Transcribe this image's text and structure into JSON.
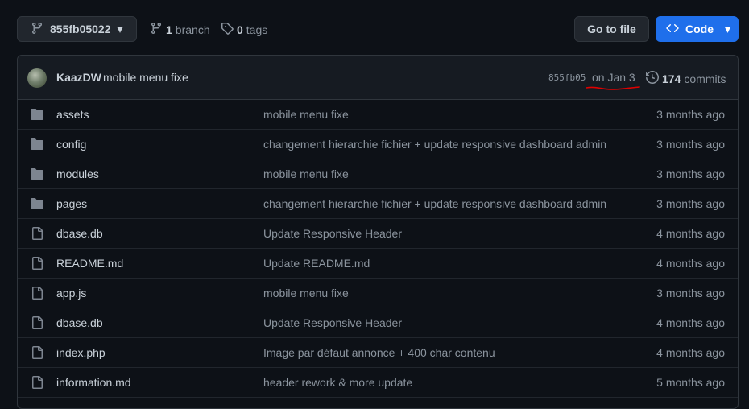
{
  "branch_selector": {
    "label": "855fb05022",
    "icon": "git-branch-icon",
    "caret": "▾"
  },
  "branches": {
    "count": "1",
    "label": "branch"
  },
  "tags": {
    "count": "0",
    "label": "tags"
  },
  "goto_file": {
    "label": "Go to file"
  },
  "code_button": {
    "label": "Code",
    "icon": "code-icon",
    "caret": "▾"
  },
  "latest_commit": {
    "author": "KaazDW",
    "message": "mobile menu fixe",
    "sha": "855fb05",
    "date": "on Jan 3",
    "commits_count": "174",
    "commits_label": "commits",
    "annotation_color": "#e00000"
  },
  "files": [
    {
      "type": "folder",
      "name": "assets",
      "message": "mobile menu fixe",
      "age": "3 months ago"
    },
    {
      "type": "folder",
      "name": "config",
      "message": "changement hierarchie fichier + update responsive dashboard admin",
      "age": "3 months ago"
    },
    {
      "type": "folder",
      "name": "modules",
      "message": "mobile menu fixe",
      "age": "3 months ago"
    },
    {
      "type": "folder",
      "name": "pages",
      "message": "changement hierarchie fichier + update responsive dashboard admin",
      "age": "3 months ago"
    },
    {
      "type": "file",
      "name": "dbase.db",
      "message": "Update Responsive Header",
      "age": "4 months ago"
    },
    {
      "type": "file",
      "name": "README.md",
      "message": "Update README.md",
      "age": "4 months ago"
    },
    {
      "type": "file",
      "name": "app.js",
      "message": "mobile menu fixe",
      "age": "3 months ago"
    },
    {
      "type": "file",
      "name": "dbase.db",
      "message": "Update Responsive Header",
      "age": "4 months ago"
    },
    {
      "type": "file",
      "name": "index.php",
      "message": "Image par défaut annonce + 400 char contenu",
      "age": "4 months ago"
    },
    {
      "type": "file",
      "name": "information.md",
      "message": "header rework & more update",
      "age": "5 months ago"
    }
  ],
  "colors": {
    "background": "#0d1117",
    "accent": "#1f6feb",
    "folder": "#7d8590",
    "muted": "#8b949e"
  }
}
